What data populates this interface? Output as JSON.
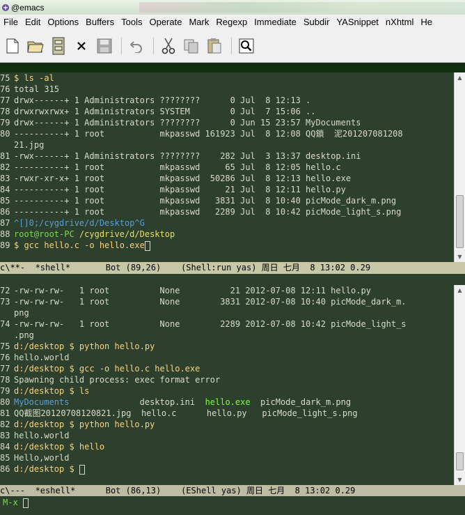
{
  "window": {
    "title": "@emacs"
  },
  "menu": [
    "File",
    "Edit",
    "Options",
    "Buffers",
    "Tools",
    "Operate",
    "Mark",
    "Regexp",
    "Immediate",
    "Subdir",
    "YASnippet",
    "nXhtml",
    "He"
  ],
  "toolbar": [
    "new-file-icon",
    "open-folder-icon",
    "cabinet-icon",
    "close-icon",
    "save-icon",
    "undo-icon",
    "cut-icon",
    "copy-icon",
    "paste-icon",
    "search-icon"
  ],
  "shell_pane": {
    "lines": [
      {
        "n": "75",
        "parts": [
          {
            "t": "$ ls -al",
            "c": "c-prompt"
          }
        ]
      },
      {
        "n": "76",
        "parts": [
          {
            "t": "total 315"
          }
        ]
      },
      {
        "n": "77",
        "parts": [
          {
            "t": "drwx------+ 1 Administrators ????????      0 Jul  8 12:13 ."
          }
        ]
      },
      {
        "n": "78",
        "parts": [
          {
            "t": "drwxrwxrwx+ 1 Administrators SYSTEM        0 Jul  7 15:06 .."
          }
        ]
      },
      {
        "n": "79",
        "parts": [
          {
            "t": "drwx------+ 1 Administrators ????????      0 Jun 15 23:57 MyDocuments"
          }
        ]
      },
      {
        "n": "80",
        "parts": [
          {
            "t": "----------+ 1 root           mkpasswd 161923 Jul  8 12:08 QQ鎖  泥201207081208"
          }
        ]
      },
      {
        "n": "",
        "parts": [
          {
            "t": "21.jpg"
          }
        ]
      },
      {
        "n": "81",
        "parts": [
          {
            "t": "-rwx------+ 1 Administrators ????????    282 Jul  3 13:37 desktop.ini"
          }
        ]
      },
      {
        "n": "82",
        "parts": [
          {
            "t": "----------+ 1 root           mkpasswd     65 Jul  8 12:05 hello.c"
          }
        ]
      },
      {
        "n": "83",
        "parts": [
          {
            "t": "-rwxr-xr-x+ 1 root           mkpasswd  50286 Jul  8 12:13 hello.exe"
          }
        ]
      },
      {
        "n": "84",
        "parts": [
          {
            "t": "----------+ 1 root           mkpasswd     21 Jul  8 12:11 hello.py"
          }
        ]
      },
      {
        "n": "85",
        "parts": [
          {
            "t": "----------+ 1 root           mkpasswd   3831 Jul  8 10:40 picMode_dark_m.png"
          }
        ]
      },
      {
        "n": "86",
        "parts": [
          {
            "t": "----------+ 1 root           mkpasswd   2289 Jul  8 10:42 picMode_light_s.png"
          }
        ]
      },
      {
        "n": "87",
        "parts": [
          {
            "t": "^[]0;/cygdrive/d/Desktop^G",
            "c": "c-blue"
          }
        ]
      },
      {
        "n": "88",
        "parts": [
          {
            "t": "root@root-PC ",
            "c": "c-green"
          },
          {
            "t": "/cygdrive/d/Desktop",
            "c": "c-yellow"
          }
        ]
      },
      {
        "n": "89",
        "parts": [
          {
            "t": "$ gcc hello.c -o hello.exe",
            "c": "c-prompt"
          }
        ],
        "cursor": true
      }
    ],
    "modeline": "c\\**-  *shell*       Bot (89,26)    (Shell:run yas) 周日 七月  8 13:02 0.29"
  },
  "eshell_pane": {
    "lines": [
      {
        "n": "72",
        "parts": [
          {
            "t": "-rw-rw-rw-   1 root          None          21 2012-07-08 12:11 hello.py"
          }
        ]
      },
      {
        "n": "73",
        "parts": [
          {
            "t": "-rw-rw-rw-   1 root          None        3831 2012-07-08 10:40 picMode_dark_m."
          }
        ]
      },
      {
        "n": "",
        "parts": [
          {
            "t": "png"
          }
        ]
      },
      {
        "n": "74",
        "parts": [
          {
            "t": "-rw-rw-rw-   1 root          None        2289 2012-07-08 10:42 picMode_light_s"
          }
        ]
      },
      {
        "n": "",
        "parts": [
          {
            "t": ".png"
          }
        ]
      },
      {
        "n": "75",
        "parts": [
          {
            "t": "d:/desktop $ python hello.py",
            "c": "c-prompt"
          }
        ]
      },
      {
        "n": "76",
        "parts": [
          {
            "t": "hello.world"
          }
        ]
      },
      {
        "n": "77",
        "parts": [
          {
            "t": "d:/desktop $ gcc -o hello.c hello.exe",
            "c": "c-prompt"
          }
        ]
      },
      {
        "n": "78",
        "parts": [
          {
            "t": "Spawning child process: exec format error"
          }
        ]
      },
      {
        "n": "79",
        "parts": [
          {
            "t": "d:/desktop $ ls",
            "c": "c-prompt"
          }
        ]
      },
      {
        "n": "80",
        "parts": [
          {
            "t": "MyDocuments",
            "c": "c-blue"
          },
          {
            "t": "              desktop.ini  "
          },
          {
            "t": "hello.exe",
            "c": "c-exe"
          },
          {
            "t": "  picMode_dark_m.png"
          }
        ]
      },
      {
        "n": "81",
        "parts": [
          {
            "t": "QQ截图20120708120821.jpg  hello.c      hello.py   picMode_light_s.png"
          }
        ]
      },
      {
        "n": "82",
        "parts": [
          {
            "t": "d:/desktop $ python hello.py",
            "c": "c-prompt"
          }
        ]
      },
      {
        "n": "83",
        "parts": [
          {
            "t": "hello.world"
          }
        ]
      },
      {
        "n": "84",
        "parts": [
          {
            "t": "d:/desktop $ hello",
            "c": "c-prompt"
          }
        ]
      },
      {
        "n": "85",
        "parts": [
          {
            "t": "Hello,world"
          }
        ]
      },
      {
        "n": "86",
        "parts": [
          {
            "t": "d:/desktop $ ",
            "c": "c-prompt"
          }
        ],
        "cursor": true
      }
    ],
    "modeline": "c\\---  *eshell*      Bot (86,13)    (EShell yas) 周日 七月  8 13:02 0.29"
  },
  "minibuffer": {
    "prompt": "M-x"
  }
}
